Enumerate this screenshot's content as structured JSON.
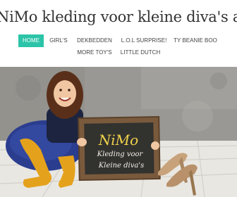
{
  "site": {
    "title": "NiMo kleding voor kleine diva's and more"
  },
  "nav": {
    "items": [
      {
        "label": "HOME",
        "active": true
      },
      {
        "label": "GIRL'S"
      },
      {
        "label": "DEKBEDDEN"
      },
      {
        "label": "L.O.L SURPRISE!"
      },
      {
        "label": "TY BEANIE BOO"
      },
      {
        "label": "MORE TOY'S"
      },
      {
        "label": "LITTLE DUTCH"
      }
    ]
  },
  "hero": {
    "chalkboard": {
      "brand": "NiMo",
      "line1": "Kleding voor",
      "line2": "Kleine diva's"
    }
  },
  "colors": {
    "accent": "#2cc4a8",
    "chalk_yellow": "#f0d24a"
  }
}
